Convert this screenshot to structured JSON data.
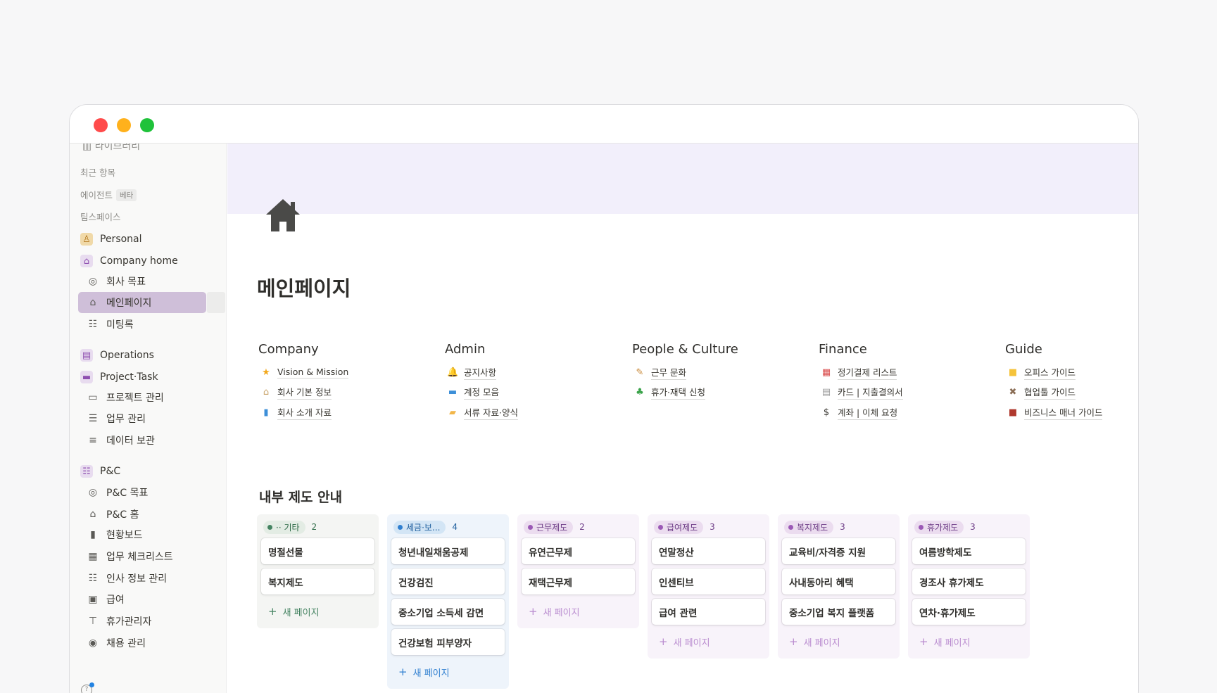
{
  "window": {
    "controls": [
      "close",
      "minimize",
      "zoom"
    ]
  },
  "sidebar": {
    "cut_item": "라이브러리",
    "recent_label": "최근 항목",
    "agent_label": "에이전트",
    "agent_badge": "베타",
    "teamspace_label": "팀스페이스",
    "items": [
      {
        "label": "Personal",
        "icon": "person-icon"
      },
      {
        "label": "Company home",
        "icon": "house-icon"
      },
      {
        "label": "회사 목표",
        "icon": "target-icon"
      },
      {
        "label": "메인페이지",
        "icon": "house-icon"
      },
      {
        "label": "미팅록",
        "icon": "people-icon"
      },
      {
        "label": "Operations",
        "icon": "briefcase-icon"
      },
      {
        "label": "Project·Task",
        "icon": "folder-icon"
      },
      {
        "label": "프로젝트 관리",
        "icon": "archive-icon"
      },
      {
        "label": "업무 관리",
        "icon": "checklist-icon"
      },
      {
        "label": "데이터 보관",
        "icon": "database-icon"
      },
      {
        "label": "P&C",
        "icon": "people-icon"
      },
      {
        "label": "P&C 목표",
        "icon": "target-icon"
      },
      {
        "label": "P&C 홈",
        "icon": "house-icon"
      },
      {
        "label": "현황보드",
        "icon": "book-icon"
      },
      {
        "label": "업무 체크리스트",
        "icon": "calendar-icon"
      },
      {
        "label": "인사 정보 관리",
        "icon": "people-icon"
      },
      {
        "label": "급여",
        "icon": "money-icon"
      },
      {
        "label": "휴가관리자",
        "icon": "palm-icon"
      },
      {
        "label": "채용 관리",
        "icon": "user-circle-icon"
      }
    ]
  },
  "page": {
    "title": "메인페이지",
    "icon": "house-icon"
  },
  "columns": [
    {
      "title": "Company",
      "links": [
        {
          "label": "Vision & Mission",
          "icon": "star-icon",
          "glyph": "★",
          "color": "#f2a81d"
        },
        {
          "label": "회사 기본 정보",
          "icon": "house-icon",
          "glyph": "⌂",
          "color": "#c9a46a"
        },
        {
          "label": "회사 소개 자료",
          "icon": "book-icon",
          "glyph": "▮",
          "color": "#3d8fd8"
        }
      ]
    },
    {
      "title": "Admin",
      "links": [
        {
          "label": "공지사항",
          "icon": "bell-icon",
          "glyph": "🔔",
          "color": "#f2b31d"
        },
        {
          "label": "계정 모음",
          "icon": "computer-icon",
          "glyph": "▬",
          "color": "#3d8fd8"
        },
        {
          "label": "서류 자료·양식",
          "icon": "folder-icon",
          "glyph": "▰",
          "color": "#f2b64a"
        }
      ]
    },
    {
      "title": "People & Culture",
      "links": [
        {
          "label": "근무 문화",
          "icon": "broom-icon",
          "glyph": "✎",
          "color": "#c98a3a"
        },
        {
          "label": "휴가·재택 신청",
          "icon": "palm-icon",
          "glyph": "♣",
          "color": "#3aa34a"
        }
      ]
    },
    {
      "title": "Finance",
      "links": [
        {
          "label": "정기결제 리스트",
          "icon": "calendar-icon",
          "glyph": "▦",
          "color": "#d94a4a"
        },
        {
          "label": "카드 | 지출결의서",
          "icon": "receipt-icon",
          "glyph": "▤",
          "color": "#9a9a9a"
        },
        {
          "label": "계좌 | 이체 요청",
          "icon": "dollar-icon",
          "glyph": "$",
          "color": "#37352f"
        }
      ]
    },
    {
      "title": "Guide",
      "links": [
        {
          "label": "오피스 가이드",
          "icon": "square-icon",
          "glyph": "■",
          "color": "#f5c33b"
        },
        {
          "label": "협업툴 가이드",
          "icon": "tools-icon",
          "glyph": "✖",
          "color": "#8a6d55"
        },
        {
          "label": "비즈니스 매너 가이드",
          "icon": "briefcase-icon",
          "glyph": "■",
          "color": "#b0392e"
        }
      ]
    }
  ],
  "board": {
    "title": "내부 제도 안내",
    "new_page_label": "새 페이지",
    "groups": [
      {
        "label": "·· 기타",
        "count": "2",
        "bg": "#f4f5f3",
        "chip_bg": "#e3ece4",
        "dot": "#448361",
        "text": "#2e6b47",
        "accent": "#448361",
        "cards": [
          "명절선물",
          "복지제도"
        ]
      },
      {
        "label": "세금·보...",
        "count": "4",
        "bg": "#eef4fb",
        "chip_bg": "#d3e5f5",
        "dot": "#2f7fd0",
        "text": "#1f5f9e",
        "accent": "#2f7fd0",
        "cards": [
          "청년내일채움공제",
          "건강검진",
          "중소기업 소득세 감면",
          "건강보험 피부양자"
        ]
      },
      {
        "label": "근무제도",
        "count": "2",
        "bg": "#f8f3fa",
        "chip_bg": "#ebdcef",
        "dot": "#9b59b6",
        "text": "#6e3d87",
        "accent": "#b98bcf",
        "cards": [
          "유연근무제",
          "재택근무제"
        ]
      },
      {
        "label": "급여제도",
        "count": "3",
        "bg": "#f8f3fa",
        "chip_bg": "#ebdcef",
        "dot": "#9b59b6",
        "text": "#6e3d87",
        "accent": "#b98bcf",
        "cards": [
          "연말정산",
          "인센티브",
          "급여 관련"
        ]
      },
      {
        "label": "복지제도",
        "count": "3",
        "bg": "#f8f3fa",
        "chip_bg": "#ebdcef",
        "dot": "#9b59b6",
        "text": "#6e3d87",
        "accent": "#b98bcf",
        "cards": [
          "교육비/자격증 지원",
          "사내동아리 혜택",
          "중소기업 복지 플랫폼"
        ]
      },
      {
        "label": "휴가제도",
        "count": "3",
        "bg": "#f8f3fa",
        "chip_bg": "#ebdcef",
        "dot": "#9b59b6",
        "text": "#6e3d87",
        "accent": "#b98bcf",
        "cards": [
          "여름방학제도",
          "경조사 휴가제도",
          "연차·휴가제도"
        ]
      }
    ]
  }
}
